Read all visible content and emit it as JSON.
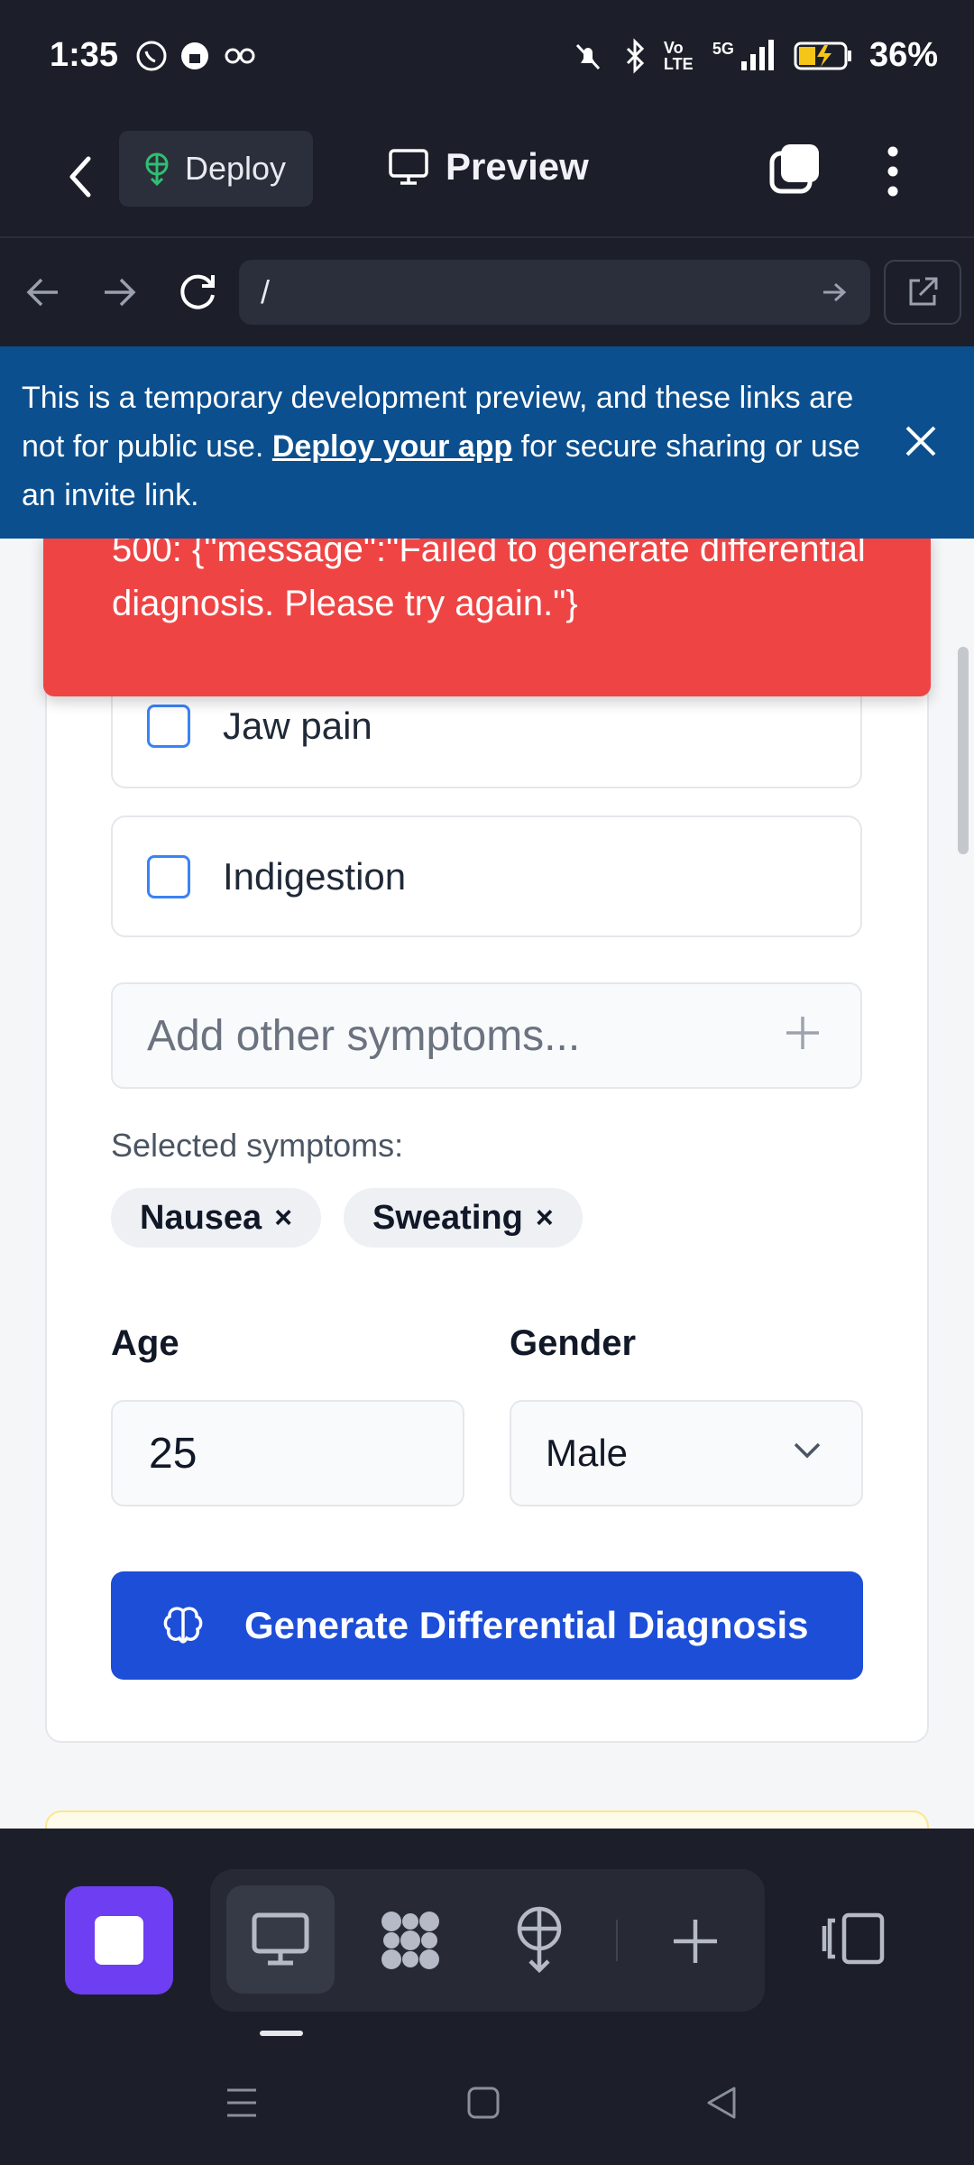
{
  "status_bar": {
    "time": "1:35",
    "battery": "36%",
    "network": "5G",
    "volte": "Vo LTE"
  },
  "app_header": {
    "deploy_label": "Deploy",
    "preview_label": "Preview"
  },
  "url_bar": {
    "url": "/"
  },
  "banner": {
    "text_before": "This is a temporary development preview, and these links are not for public use. ",
    "link_text": "Deploy your app",
    "text_after": " for secure sharing or use an invite link."
  },
  "error_toast": {
    "message": "500: {\"message\":\"Failed to generate differential diagnosis. Please try again.\"}"
  },
  "symptoms_form": {
    "options": [
      {
        "label": "Jaw pain",
        "checked": false
      },
      {
        "label": "Indigestion",
        "checked": false
      }
    ],
    "add_placeholder": "Add other symptoms...",
    "selected_label": "Selected symptoms:",
    "selected": [
      {
        "label": "Nausea",
        "remove": "×"
      },
      {
        "label": "Sweating",
        "remove": "×"
      }
    ],
    "age_label": "Age",
    "age_value": "25",
    "gender_label": "Gender",
    "gender_value": "Male",
    "generate_button": "Generate Differential Diagnosis"
  },
  "colors": {
    "accent": "#1d4ed8",
    "error": "#ef4444",
    "banner": "#0b4f8f",
    "stop_button": "#6d3ef2"
  }
}
